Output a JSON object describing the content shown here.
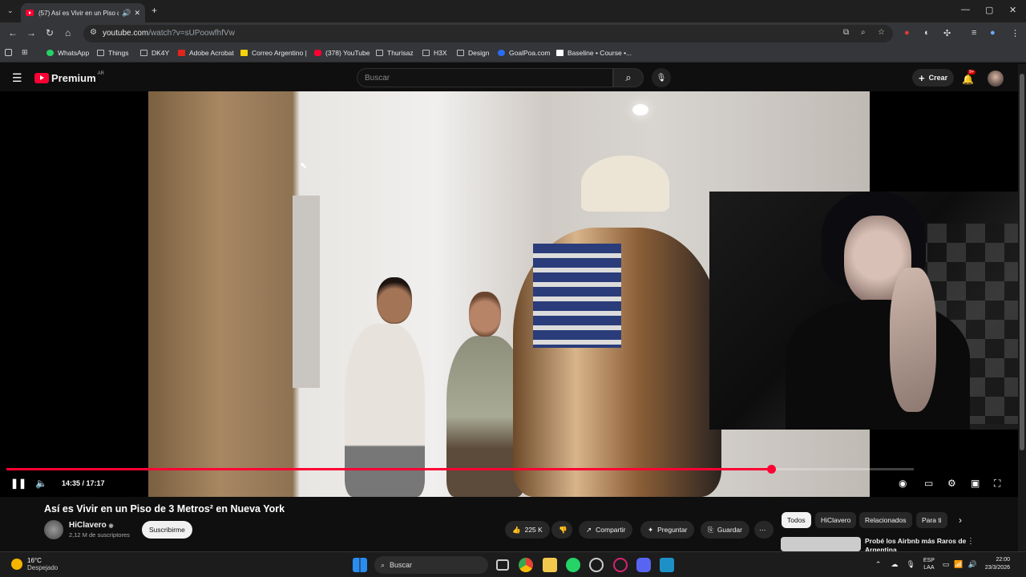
{
  "browser": {
    "tab_title": "(57) Así es Vivir en un Piso d",
    "url_host": "youtube.com",
    "url_path": "/watch?v=sUPoowfhfVw",
    "new_tab": "+",
    "win_minimize": "—",
    "win_maximize": "▢",
    "win_close": "✕"
  },
  "bookmarks": [
    {
      "label": "WhatsApp",
      "icon": "whatsapp-icon",
      "color": "#25d366"
    },
    {
      "label": "Things",
      "icon": "folder-icon",
      "color": "folder"
    },
    {
      "label": "DK4Y",
      "icon": "folder-icon",
      "color": "folder"
    },
    {
      "label": "Adobe Acrobat",
      "icon": "acrobat-icon",
      "color": "#e1251b"
    },
    {
      "label": "Correo Argentino |",
      "icon": "correo-icon",
      "color": "#f5d20a"
    },
    {
      "label": "(378) YouTube",
      "icon": "youtube-icon",
      "color": "#ff0033"
    },
    {
      "label": "Thurisaz",
      "icon": "folder-icon",
      "color": "folder"
    },
    {
      "label": "H3X",
      "icon": "folder-icon",
      "color": "folder"
    },
    {
      "label": "Design",
      "icon": "folder-icon",
      "color": "folder"
    },
    {
      "label": "GoalPoa.com",
      "icon": "goalpoa-icon",
      "color": "#2a6df4"
    },
    {
      "label": "Baseline • Course •...",
      "icon": "baseline-icon",
      "color": "#ffffff"
    }
  ],
  "youtube": {
    "logo_text": "Premium",
    "logo_country": "AR",
    "search_placeholder": "Buscar",
    "create_label": "Crear",
    "notif_count": "9+"
  },
  "player": {
    "current_time": "14:35",
    "duration": "17:17",
    "time_display": "14:35 / 17:17",
    "progress": 0.843,
    "accent": "#ff0033"
  },
  "video": {
    "title": "Así es Vivir en un Piso de 3 Metros² en Nueva York",
    "channel": "HiClavero",
    "subscribers": "2,12 M de suscriptores",
    "subscribe_label": "Suscribirme",
    "likes": "225 K",
    "share_label": "Compartir",
    "ask_label": "Preguntar",
    "save_label": "Guardar"
  },
  "chips": [
    "Todos",
    "HiClavero",
    "Relacionados",
    "Para ti"
  ],
  "recommendation": {
    "title": "Probé los Airbnb más Raros de Argentina"
  },
  "taskbar": {
    "temp": "16°C",
    "weather": "Despejado",
    "search_label": "Buscar",
    "lang1": "ESP",
    "lang2": "LAA",
    "time": "22:00",
    "date": "23/3/2026"
  }
}
